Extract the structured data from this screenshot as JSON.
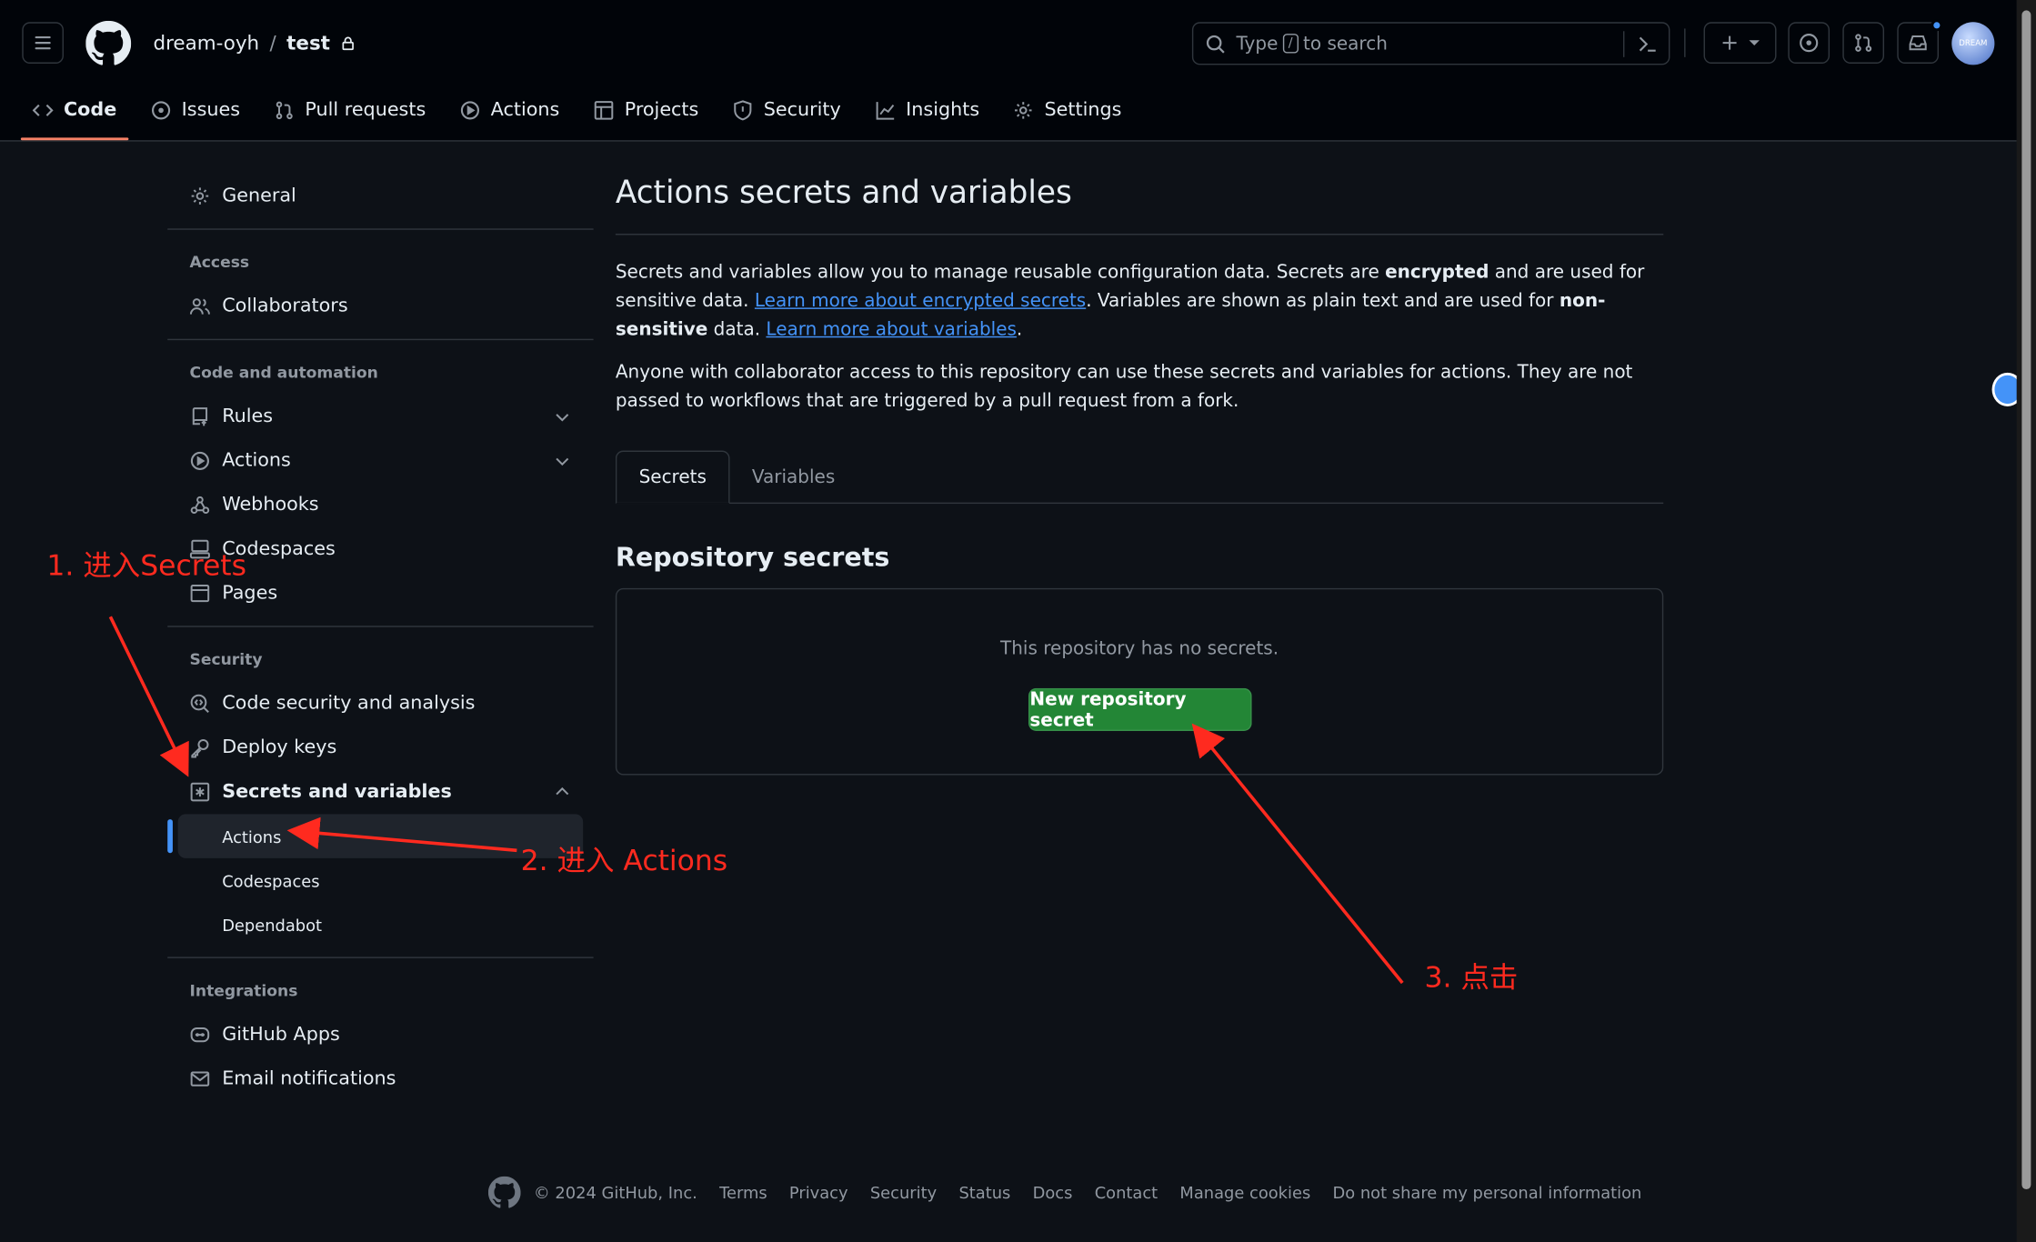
{
  "header": {
    "owner": "dream-oyh",
    "separator": "/",
    "repo": "test",
    "search": {
      "prefix": "Type",
      "key": "/",
      "suffix": "to search"
    },
    "avatar_text": "DREAM"
  },
  "nav": {
    "tabs": [
      {
        "label": "Code",
        "icon": "code-icon",
        "selected": true
      },
      {
        "label": "Issues",
        "icon": "issue-icon"
      },
      {
        "label": "Pull requests",
        "icon": "pull-request-icon"
      },
      {
        "label": "Actions",
        "icon": "play-icon"
      },
      {
        "label": "Projects",
        "icon": "table-icon"
      },
      {
        "label": "Security",
        "icon": "shield-icon"
      },
      {
        "label": "Insights",
        "icon": "graph-icon"
      },
      {
        "label": "Settings",
        "icon": "gear-icon"
      }
    ]
  },
  "sidebar": {
    "general": "General",
    "access_group": "Access",
    "collaborators": "Collaborators",
    "code_group": "Code and automation",
    "rules": "Rules",
    "actions": "Actions",
    "webhooks": "Webhooks",
    "codespaces": "Codespaces",
    "pages": "Pages",
    "security_group": "Security",
    "code_security": "Code security and analysis",
    "deploy_keys": "Deploy keys",
    "secrets": "Secrets and variables",
    "secrets_actions": "Actions",
    "secrets_codespaces": "Codespaces",
    "secrets_dependabot": "Dependabot",
    "integrations_group": "Integrations",
    "github_apps": "GitHub Apps",
    "email_notifications": "Email notifications"
  },
  "main": {
    "title": "Actions secrets and variables",
    "intro": {
      "t1": "Secrets and variables allow you to manage reusable configuration data. Secrets are ",
      "b1": "encrypted",
      "t2": " and are used for sensitive data. ",
      "link1": "Learn more about encrypted secrets",
      "t3": ". Variables are shown as plain text and are used for ",
      "b2": "non-sensitive",
      "t4": " data. ",
      "link2": "Learn more about variables",
      "t5": "."
    },
    "notice": "Anyone with collaborator access to this repository can use these secrets and variables for actions. They are not passed to workflows that are triggered by a pull request from a fork.",
    "tab_secrets": "Secrets",
    "tab_variables": "Variables",
    "section_title": "Repository secrets",
    "empty_text": "This repository has no secrets.",
    "new_button": "New repository secret"
  },
  "footer": {
    "copyright": "© 2024 GitHub, Inc.",
    "links": [
      "Terms",
      "Privacy",
      "Security",
      "Status",
      "Docs",
      "Contact",
      "Manage cookies",
      "Do not share my personal information"
    ]
  },
  "annotations": {
    "step1": "1. 进入Secrets",
    "step2": "2. 进入 Actions",
    "step3": "3. 点击",
    "color": "#ff2a1f"
  },
  "colors": {
    "accent": "#4493f8",
    "green": "#238636",
    "tab_underline": "#f78166"
  }
}
